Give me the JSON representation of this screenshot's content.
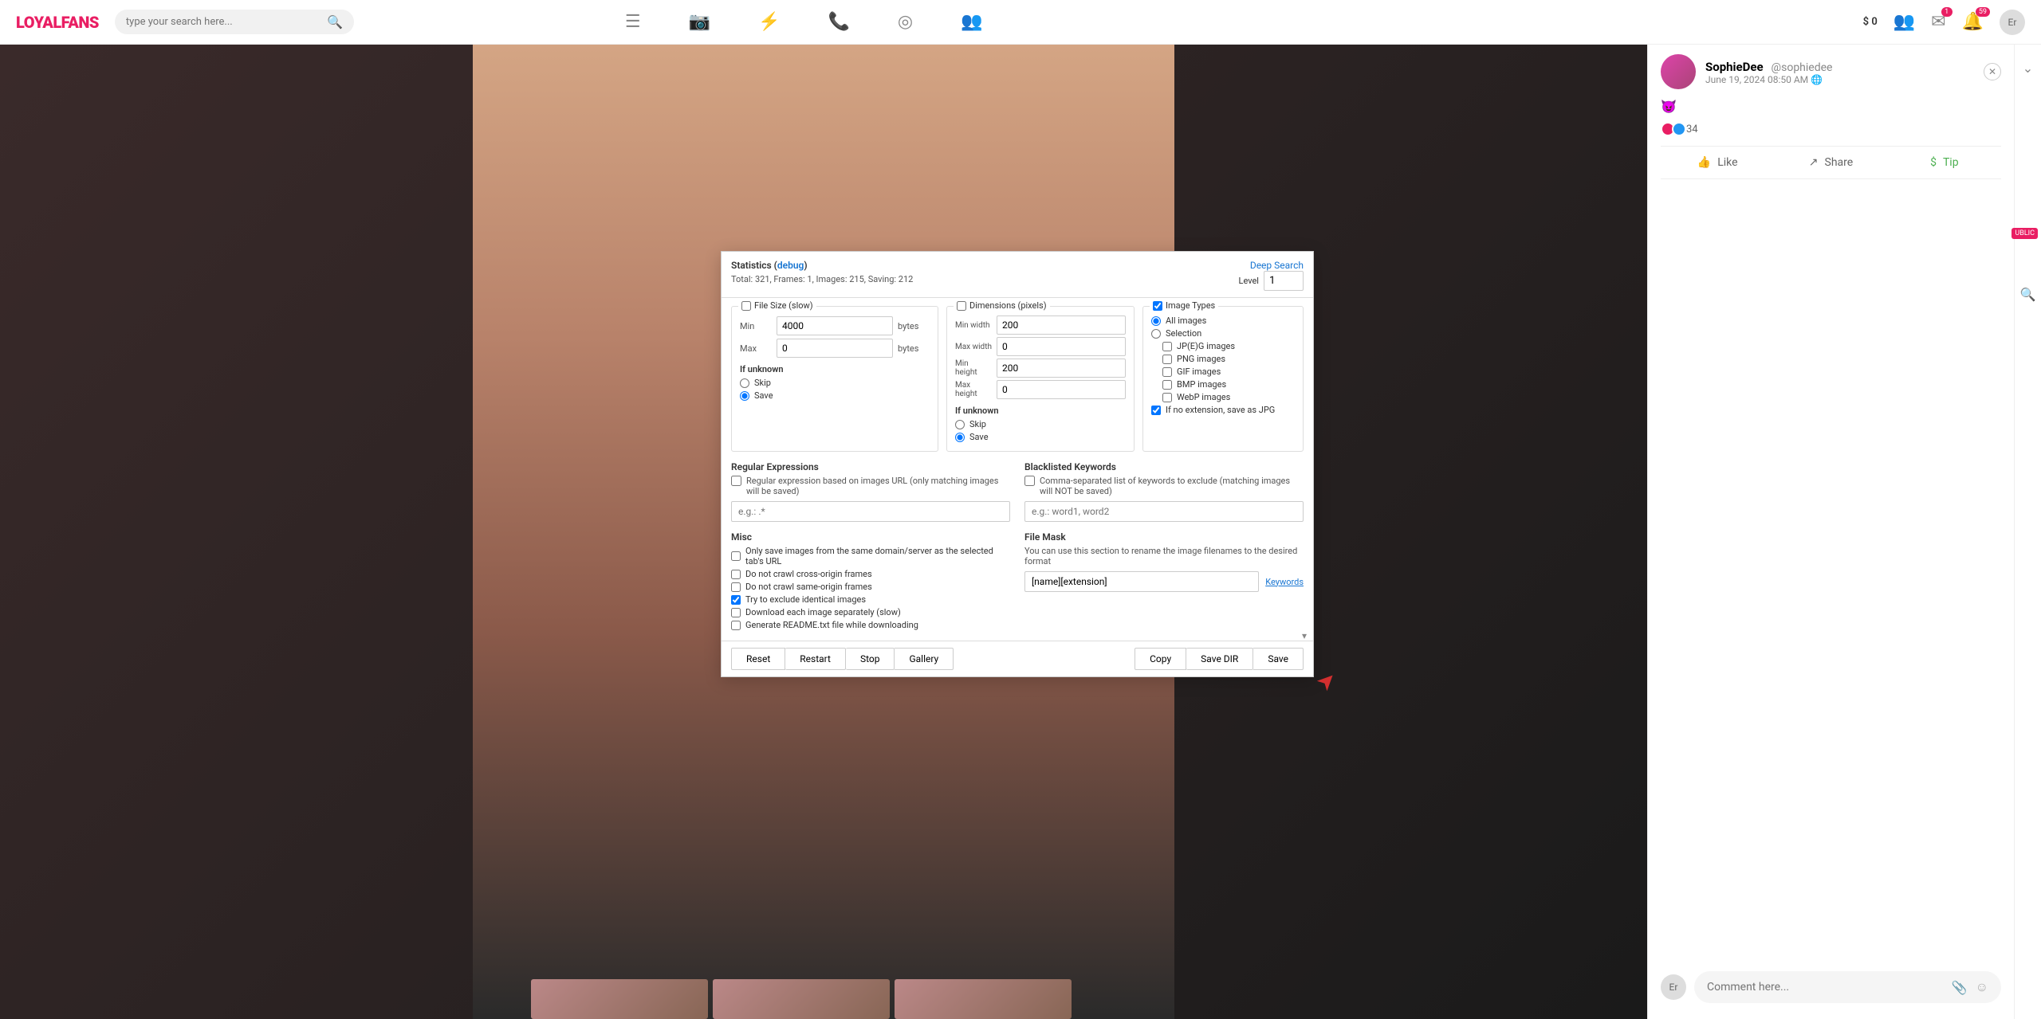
{
  "topbar": {
    "logo": "LOYALFANS",
    "search_placeholder": "type your search here...",
    "money": "$ 0",
    "msg_badge": "1",
    "notif_badge": "59",
    "avatar_text": "Er"
  },
  "post": {
    "name": "SophieDee",
    "handle": "@sophiedee",
    "date": "June 19, 2024 08:50 AM",
    "emoji": "😈",
    "reactions_count": "34",
    "like_label": "Like",
    "share_label": "Share",
    "tip_label": "Tip",
    "comment_placeholder": "Comment here...",
    "comment_avatar": "Er"
  },
  "rail": {
    "public_badge": "UBLIC"
  },
  "dialog": {
    "stats_title": "Statistics",
    "debug_link": "debug",
    "stats_total_label": "Total:",
    "stats_total": "321",
    "stats_frames_label": "Frames:",
    "stats_frames": "1",
    "stats_images_label": "Images:",
    "stats_images": "215",
    "stats_saving_label": "Saving:",
    "stats_saving": "212",
    "deep_search": "Deep Search",
    "level_label": "Level",
    "level_value": "1",
    "filesize": {
      "title": "File Size (slow)",
      "min_label": "Min",
      "min_value": "4000",
      "max_label": "Max",
      "max_value": "0",
      "unit": "bytes",
      "unknown_title": "If unknown",
      "skip": "Skip",
      "save": "Save"
    },
    "dimensions": {
      "title": "Dimensions (pixels)",
      "minw_label": "Min width",
      "minw_value": "200",
      "maxw_label": "Max width",
      "maxw_value": "0",
      "minh_label": "Min height",
      "minh_value": "200",
      "maxh_label": "Max height",
      "maxh_value": "0",
      "unknown_title": "If unknown",
      "skip": "Skip",
      "save": "Save"
    },
    "types": {
      "title": "Image Types",
      "all": "All images",
      "selection": "Selection",
      "jpeg": "JP(E)G images",
      "png": "PNG images",
      "gif": "GIF images",
      "bmp": "BMP images",
      "webp": "WebP images",
      "noext": "If no extension, save as JPG"
    },
    "regex": {
      "title": "Regular Expressions",
      "desc": "Regular expression based on images URL (only matching images will be saved)",
      "placeholder": "e.g.: .*"
    },
    "blacklist": {
      "title": "Blacklisted Keywords",
      "desc": "Comma-separated list of keywords to exclude (matching images will NOT be saved)",
      "placeholder": "e.g.: word1, word2"
    },
    "misc": {
      "title": "Misc",
      "same_domain": "Only save images from the same domain/server as the selected tab's URL",
      "cross_origin": "Do not crawl cross-origin frames",
      "same_origin": "Do not crawl same-origin frames",
      "identical": "Try to exclude identical images",
      "separately": "Download each image separately (slow)",
      "readme": "Generate README.txt file while downloading"
    },
    "mask": {
      "title": "File Mask",
      "desc": "You can use this section to rename the image filenames to the desired format",
      "value": "[name][extension]",
      "keywords_link": "Keywords"
    },
    "buttons": {
      "reset": "Reset",
      "restart": "Restart",
      "stop": "Stop",
      "gallery": "Gallery",
      "copy": "Copy",
      "savedir": "Save DIR",
      "save": "Save"
    }
  }
}
